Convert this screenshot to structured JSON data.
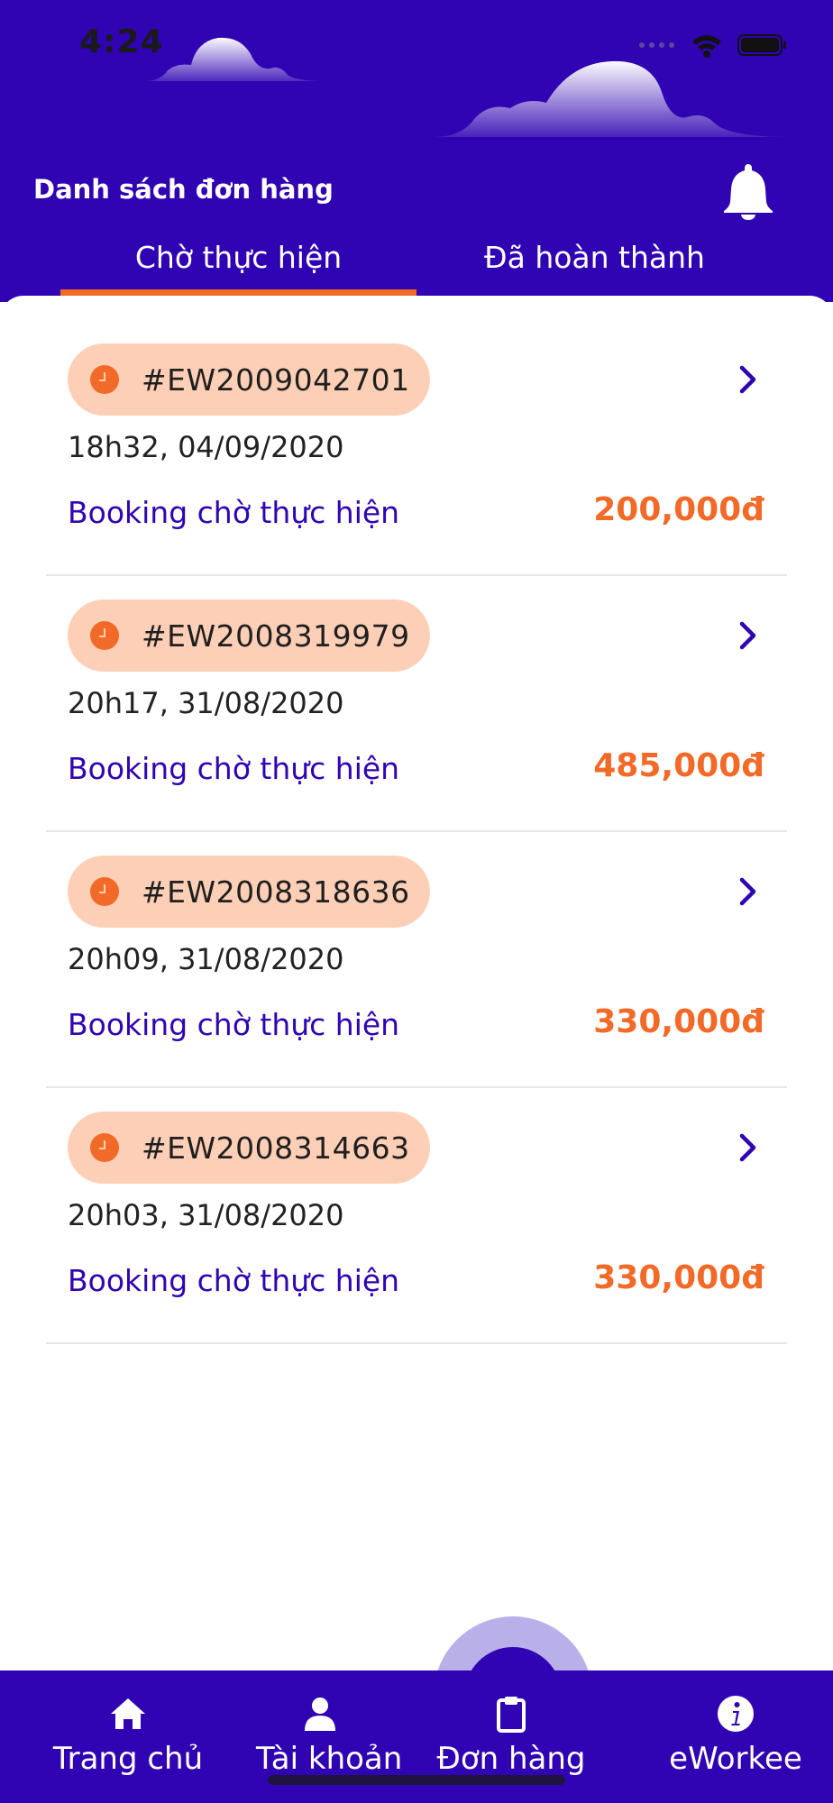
{
  "status_bar": {
    "time": "4:24"
  },
  "header": {
    "title": "Danh sách đơn hàng",
    "notification_icon": "bell-icon"
  },
  "tabs": [
    {
      "label": "Chờ thực hiện",
      "active": true
    },
    {
      "label": "Đã hoàn thành",
      "active": false
    }
  ],
  "orders": [
    {
      "code": "#EW2009042701",
      "datetime": "18h32, 04/09/2020",
      "status": "Booking chờ thực hiện",
      "price": "200,000đ"
    },
    {
      "code": "#EW2008319979",
      "datetime": "20h17, 31/08/2020",
      "status": "Booking chờ thực hiện",
      "price": "485,000đ"
    },
    {
      "code": "#EW2008318636",
      "datetime": "20h09, 31/08/2020",
      "status": "Booking chờ thực hiện",
      "price": "330,000đ"
    },
    {
      "code": "#EW2008314663",
      "datetime": "20h03, 31/08/2020",
      "status": "Booking chờ thực hiện",
      "price": "330,000đ"
    }
  ],
  "bottom_nav": [
    {
      "label": "Trang chủ",
      "icon": "home-icon"
    },
    {
      "label": "Tài khoản",
      "icon": "user-icon"
    },
    {
      "label": "Đơn hàng",
      "icon": "clipboard-icon",
      "active": true
    },
    {
      "label": "eWorkee",
      "icon": "info-icon"
    }
  ],
  "colors": {
    "primary": "#3004b2",
    "accent": "#f26a28",
    "badge_bg": "#fdcfb6",
    "fab_ring": "#b9b0ea",
    "divider": "#e6e6e6"
  }
}
